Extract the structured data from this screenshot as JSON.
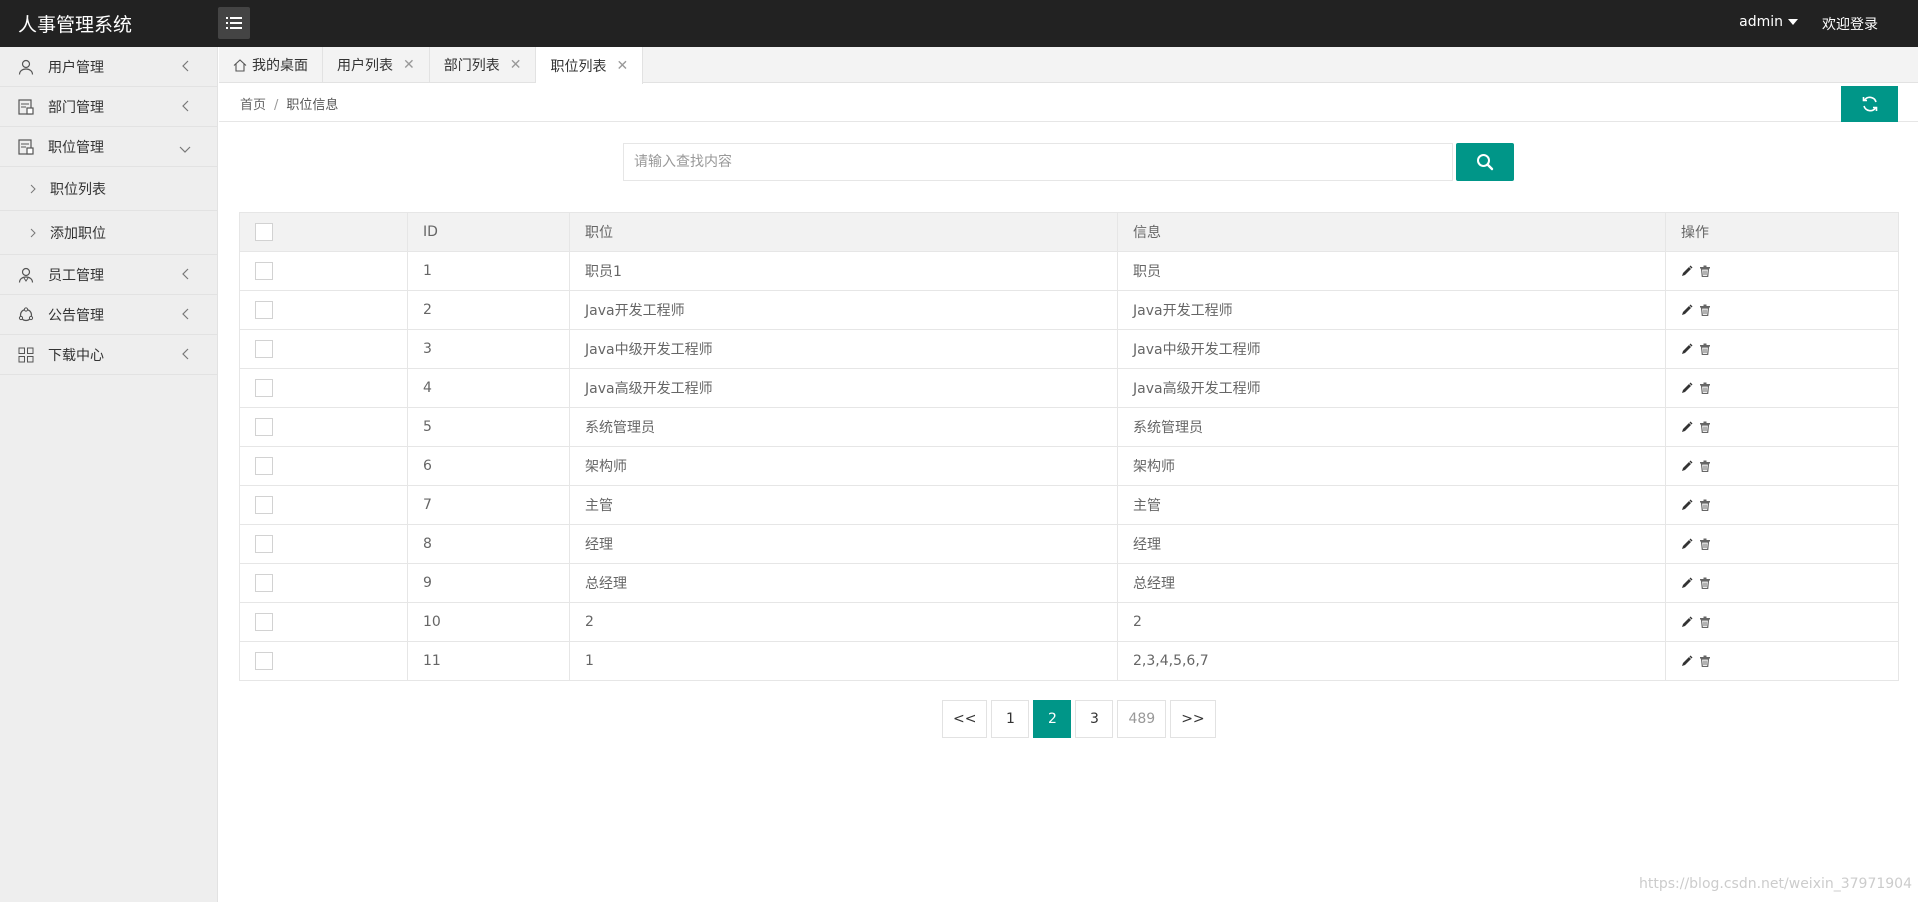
{
  "header": {
    "logo": "人事管理系统",
    "user": "admin",
    "login": "欢迎登录"
  },
  "sidebar": {
    "items": [
      {
        "label": "用户管理",
        "icon": "user-icon"
      },
      {
        "label": "部门管理",
        "icon": "department-icon"
      },
      {
        "label": "职位管理",
        "icon": "position-icon",
        "expanded": true,
        "children": [
          {
            "label": "职位列表"
          },
          {
            "label": "添加职位"
          }
        ]
      },
      {
        "label": "员工管理",
        "icon": "employee-icon"
      },
      {
        "label": "公告管理",
        "icon": "notice-icon"
      },
      {
        "label": "下载中心",
        "icon": "grid-icon"
      }
    ]
  },
  "tabs": [
    {
      "label": "我的桌面",
      "closable": false,
      "home": true
    },
    {
      "label": "用户列表",
      "closable": true
    },
    {
      "label": "部门列表",
      "closable": true
    },
    {
      "label": "职位列表",
      "closable": true,
      "active": true
    }
  ],
  "breadcrumb": {
    "home": "首页",
    "separator": "/",
    "current": "职位信息"
  },
  "search": {
    "placeholder": "请输入查找内容",
    "value": ""
  },
  "table": {
    "headers": [
      "",
      "ID",
      "职位",
      "信息",
      "操作"
    ],
    "rows": [
      {
        "id": "1",
        "name": "职员1",
        "info": "职员"
      },
      {
        "id": "2",
        "name": "Java开发工程师",
        "info": "Java开发工程师"
      },
      {
        "id": "3",
        "name": "Java中级开发工程师",
        "info": "Java中级开发工程师"
      },
      {
        "id": "4",
        "name": "Java高级开发工程师",
        "info": "Java高级开发工程师"
      },
      {
        "id": "5",
        "name": "系统管理员",
        "info": "系统管理员"
      },
      {
        "id": "6",
        "name": "架构师",
        "info": "架构师"
      },
      {
        "id": "7",
        "name": "主管",
        "info": "主管"
      },
      {
        "id": "8",
        "name": "经理",
        "info": "经理"
      },
      {
        "id": "9",
        "name": "总经理",
        "info": "总经理"
      },
      {
        "id": "10",
        "name": "2",
        "info": "2"
      },
      {
        "id": "11",
        "name": "1",
        "info": "2,3,4,5,6,7"
      }
    ]
  },
  "pagination": {
    "prev": "<<",
    "pages": [
      "1",
      "2",
      "3",
      "489"
    ],
    "current": "2",
    "next": ">>"
  },
  "watermark": "https://blog.csdn.net/weixin_37971904",
  "colors": {
    "accent": "#009688",
    "header_bg": "#222222",
    "sidebar_bg": "#eeeeee"
  }
}
